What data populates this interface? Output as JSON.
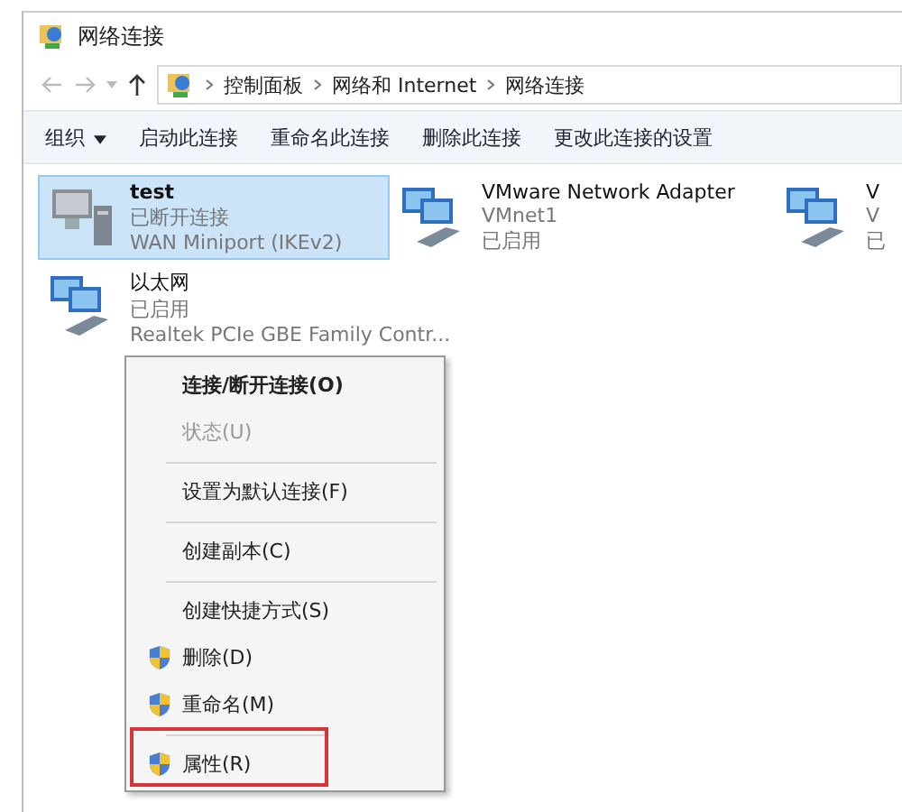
{
  "window": {
    "title": "网络连接"
  },
  "address": {
    "crumbs": [
      "控制面板",
      "网络和 Internet",
      "网络连接"
    ]
  },
  "toolbar": [
    {
      "label": "组织",
      "dropdown": true
    },
    {
      "label": "启动此连接",
      "dropdown": false
    },
    {
      "label": "重命名此连接",
      "dropdown": false
    },
    {
      "label": "删除此连接",
      "dropdown": false
    },
    {
      "label": "更改此连接的设置",
      "dropdown": false
    }
  ],
  "connections": [
    {
      "kind": "wan",
      "name": "test",
      "lines": [
        "已断开连接",
        "WAN Miniport (IKEv2)"
      ],
      "selected": true
    },
    {
      "kind": "ethernet",
      "name": "VMware Network Adapter",
      "lines": [
        "VMnet1",
        "已启用"
      ],
      "selected": false
    },
    {
      "kind": "ethernet",
      "name": "V",
      "lines": [
        "V",
        "已"
      ],
      "selected": false
    },
    {
      "kind": "ethernet",
      "name": "以太网",
      "lines": [
        "已启用",
        "Realtek PCIe GBE Family Contr..."
      ],
      "selected": false
    }
  ],
  "context_menu": [
    {
      "label": "连接/断开连接(O)",
      "bold": true,
      "disabled": false,
      "shield": false,
      "separator_before": false,
      "highlighted": false
    },
    {
      "label": "状态(U)",
      "bold": false,
      "disabled": true,
      "shield": false,
      "separator_before": false,
      "highlighted": false
    },
    {
      "label": "设置为默认连接(F)",
      "bold": false,
      "disabled": false,
      "shield": false,
      "separator_before": true,
      "highlighted": false
    },
    {
      "label": "创建副本(C)",
      "bold": false,
      "disabled": false,
      "shield": false,
      "separator_before": true,
      "highlighted": false
    },
    {
      "label": "创建快捷方式(S)",
      "bold": false,
      "disabled": false,
      "shield": false,
      "separator_before": true,
      "highlighted": false
    },
    {
      "label": "删除(D)",
      "bold": false,
      "disabled": false,
      "shield": true,
      "separator_before": false,
      "highlighted": false
    },
    {
      "label": "重命名(M)",
      "bold": false,
      "disabled": false,
      "shield": true,
      "separator_before": false,
      "highlighted": false
    },
    {
      "label": "属性(R)",
      "bold": false,
      "disabled": false,
      "shield": true,
      "separator_before": true,
      "highlighted": true
    }
  ]
}
